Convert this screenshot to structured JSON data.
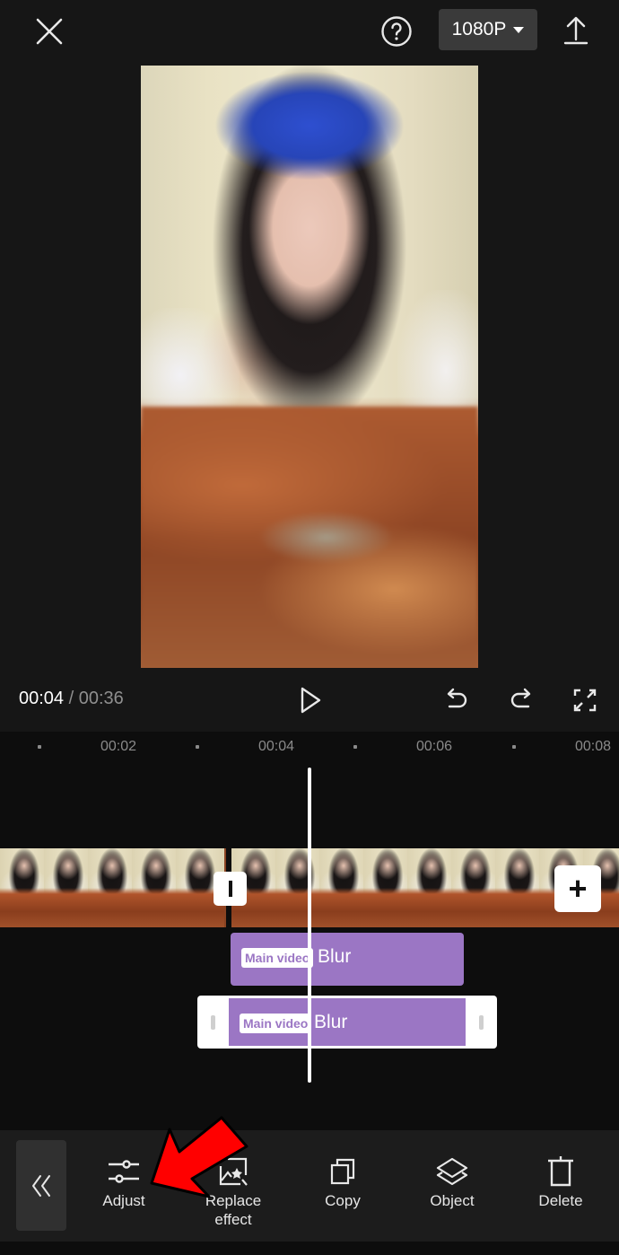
{
  "header": {
    "close_icon": "close-icon",
    "help_icon": "help-circle-icon",
    "resolution": "1080P",
    "export_icon": "upload-icon"
  },
  "playback": {
    "current_time": "00:04",
    "separator": "/",
    "total_time": "00:36",
    "play_icon": "play-icon",
    "undo_icon": "undo-icon",
    "redo_icon": "redo-icon",
    "fullscreen_icon": "fullscreen-icon"
  },
  "ruler": {
    "labels": [
      "00:02",
      "00:04",
      "00:06",
      "00:08"
    ]
  },
  "timeline": {
    "add_clip_label": "+",
    "tracks": [
      {
        "tag": "Main video",
        "label": "Blur",
        "selected": false
      },
      {
        "tag": "Main video",
        "label": "Blur",
        "selected": true
      }
    ]
  },
  "toolbar": {
    "collapse_label": "«",
    "items": [
      {
        "label": "Adjust",
        "icon": "sliders-icon"
      },
      {
        "label": "Replace effect",
        "icon": "replace-effect-icon"
      },
      {
        "label": "Copy",
        "icon": "copy-icon"
      },
      {
        "label": "Object",
        "icon": "layers-icon"
      },
      {
        "label": "Delete",
        "icon": "trash-icon"
      }
    ]
  },
  "annotation": {
    "arrow_color": "#ff0000",
    "points_to": "Adjust"
  },
  "colors": {
    "effect_track": "#9b76c4",
    "background": "#161616"
  }
}
